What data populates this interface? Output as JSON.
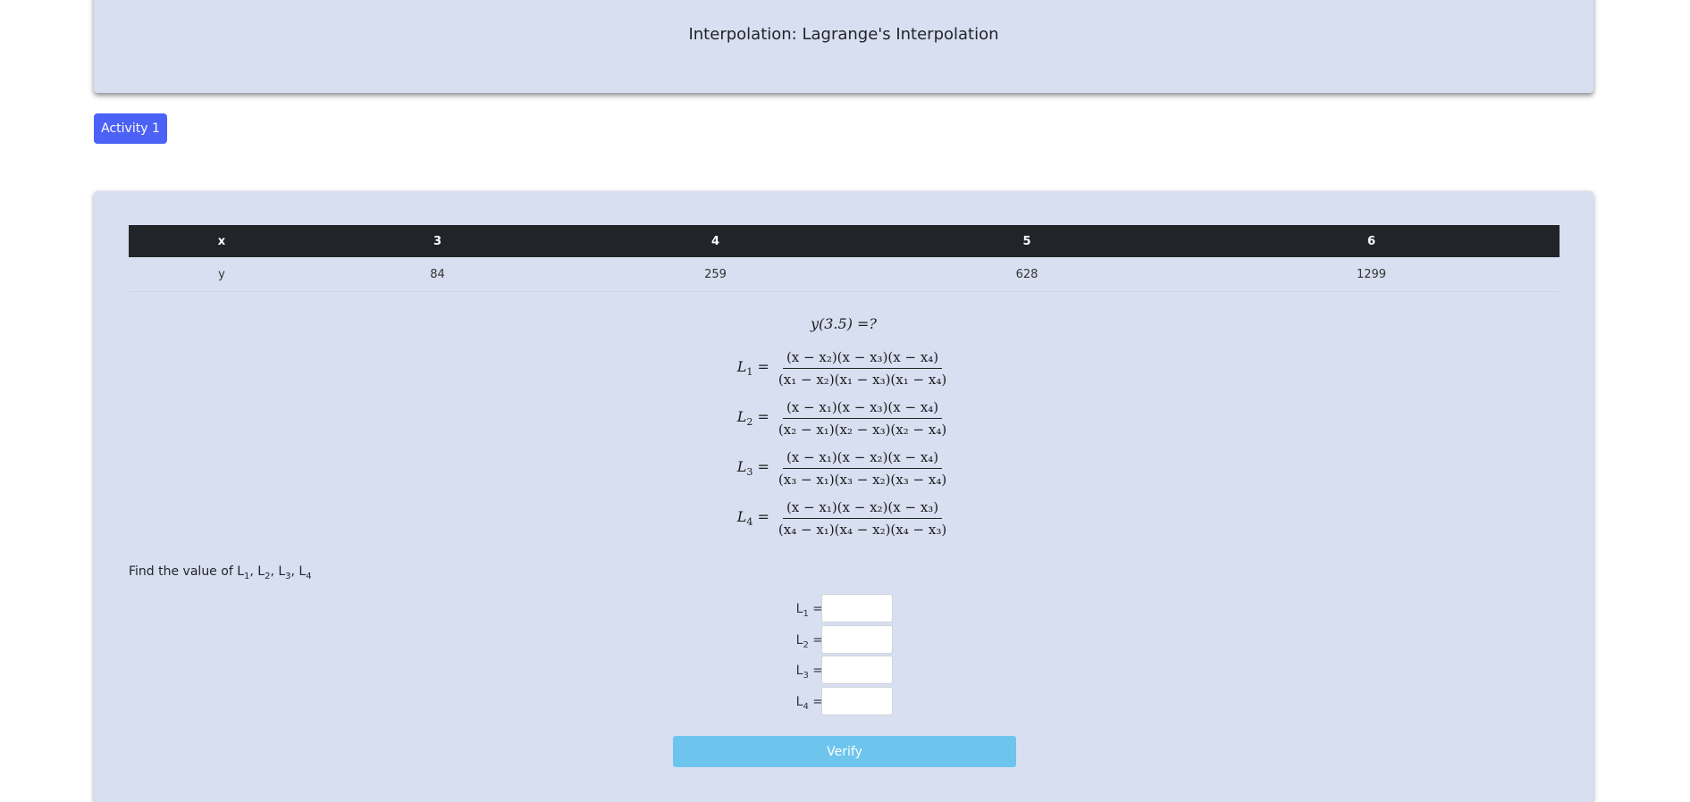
{
  "header": {
    "title": "Interpolation: Lagrange's Interpolation"
  },
  "activity_button": {
    "label": "Activity 1"
  },
  "table": {
    "headers": [
      "x",
      "3",
      "4",
      "5",
      "6"
    ],
    "row": [
      "y",
      "84",
      "259",
      "628",
      "1299"
    ]
  },
  "question": {
    "text": "y(3.5) =?"
  },
  "formulas": [
    {
      "lhs": "L",
      "sub": "1",
      "num": "(x − x₂)(x − x₃)(x − x₄)",
      "den": "(x₁ − x₂)(x₁ − x₃)(x₁ − x₄)"
    },
    {
      "lhs": "L",
      "sub": "2",
      "num": "(x − x₁)(x − x₃)(x − x₄)",
      "den": "(x₂ − x₁)(x₂ − x₃)(x₂ − x₄)"
    },
    {
      "lhs": "L",
      "sub": "3",
      "num": "(x − x₁)(x − x₂)(x − x₄)",
      "den": "(x₃ − x₁)(x₃ − x₂)(x₃ − x₄)"
    },
    {
      "lhs": "L",
      "sub": "4",
      "num": "(x − x₁)(x − x₂)(x − x₃)",
      "den": "(x₄ − x₁)(x₄ − x₂)(x₄ − x₃)"
    }
  ],
  "instruction": {
    "text": "Find the value of",
    "terms": [
      "1",
      "2",
      "3",
      "4"
    ]
  },
  "inputs": [
    {
      "label": "L",
      "sub": "1",
      "suffix": "=",
      "value": ""
    },
    {
      "label": "L",
      "sub": "2",
      "suffix": "=",
      "value": ""
    },
    {
      "label": "L",
      "sub": "3",
      "suffix": "=",
      "value": ""
    },
    {
      "label": "L",
      "sub": "4",
      "suffix": "=",
      "value": ""
    }
  ],
  "verify_button": {
    "label": "Verify"
  },
  "colors": {
    "card_bg": "#d8dff1",
    "activity_button": "#4c61f5",
    "verify_button": "#6dc5ee",
    "table_header": "#212529"
  }
}
